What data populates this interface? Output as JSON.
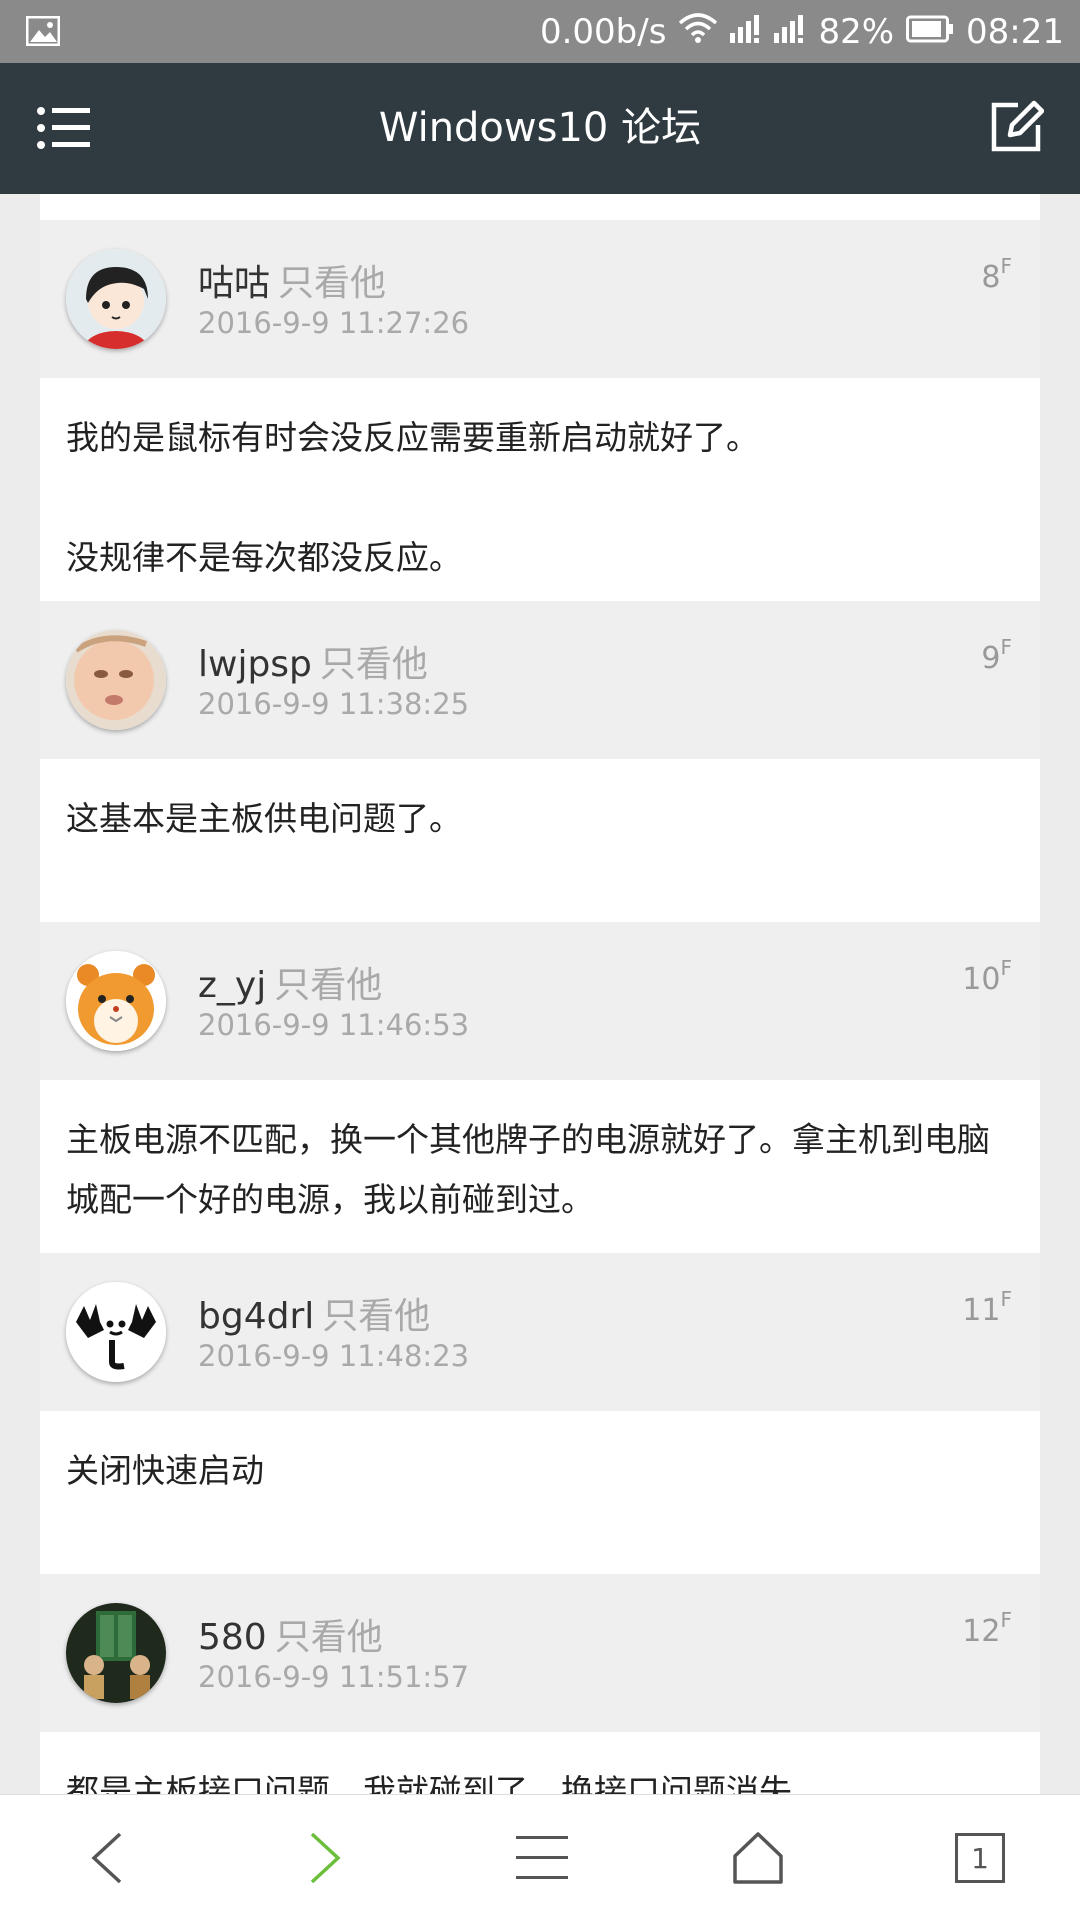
{
  "status": {
    "speed": "0.00b/s",
    "battery": "82%",
    "time": "08:21",
    "icons": [
      "gallery-icon",
      "wifi-icon",
      "signal-icon",
      "signal-icon",
      "battery-icon"
    ]
  },
  "header": {
    "title": "Windows10 论坛"
  },
  "only_label": "只看他",
  "posts": [
    {
      "user": "咕咕",
      "time": "2016-9-9 11:27:26",
      "floor": "8",
      "body": [
        "我的是鼠标有时会没反应需要重新启动就好了。",
        "",
        "没规律不是每次都没反应。"
      ]
    },
    {
      "user": "lwjpsp",
      "time": "2016-9-9 11:38:25",
      "floor": "9",
      "body": [
        "这基本是主板供电问题了。"
      ]
    },
    {
      "user": "z_yj",
      "time": "2016-9-9 11:46:53",
      "floor": "10",
      "body": [
        "主板电源不匹配，换一个其他牌子的电源就好了。拿主机到电脑城配一个好的电源，我以前碰到过。"
      ]
    },
    {
      "user": "bg4drl",
      "time": "2016-9-9 11:48:23",
      "floor": "11",
      "body": [
        "关闭快速启动"
      ]
    },
    {
      "user": "580",
      "time": "2016-9-9 11:51:57",
      "floor": "12",
      "body": [
        "都是主板接口问题，我就碰到了，换接口问题消失"
      ]
    }
  ],
  "floor_suffix": "F",
  "bottom": {
    "tab_count": "1"
  },
  "colors": {
    "topbar": "#2f3b40",
    "statusbar": "#8a8a8a",
    "forward": "#6bbf3b"
  }
}
